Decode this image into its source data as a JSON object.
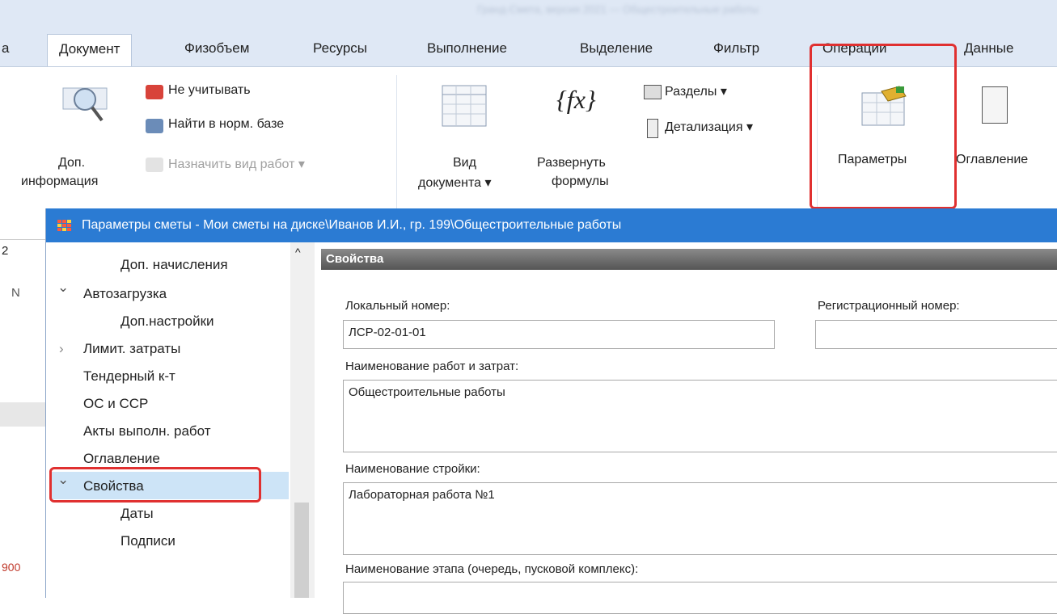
{
  "app": {
    "title_blurred": "Гранд-Смета, версия 2021 — Общестроительные работы"
  },
  "tabs": [
    {
      "label": "а"
    },
    {
      "label": "Документ"
    },
    {
      "label": "Физобъем"
    },
    {
      "label": "Ресурсы"
    },
    {
      "label": "Выполнение"
    },
    {
      "label": "Выделение"
    },
    {
      "label": "Фильтр"
    },
    {
      "label": "Операции"
    },
    {
      "label": "Данные"
    }
  ],
  "ribbon": {
    "dop_info": {
      "line1": "Доп.",
      "line2": "информация"
    },
    "ne_uchityvat": "Не учитывать",
    "nayti": "Найти в норм. базе",
    "naznachit": "Назначить вид работ ▾",
    "vid": {
      "line1": "Вид",
      "line2": "документа ▾"
    },
    "razvernut": {
      "line1": "Развернуть",
      "line2": "формулы",
      "icon_text": "{fx}"
    },
    "razdely": "Разделы ▾",
    "detalizaciya": "Детализация ▾",
    "parametry": "Параметры",
    "oglavlenie": "Оглавление"
  },
  "left_edge": {
    "n1": "2",
    "n2": "N",
    "n3": "900"
  },
  "dialog": {
    "title": "Параметры сметы - Мои сметы на диске\\Иванов И.И., гр. 199\\Общестроительные работы",
    "tree": [
      {
        "label": "Доп. начисления",
        "marker": ""
      },
      {
        "label": "Автозагрузка",
        "marker": "⌄"
      },
      {
        "label": "Доп.настройки",
        "marker": ""
      },
      {
        "label": "Лимит. затраты",
        "marker": "›"
      },
      {
        "label": "Тендерный к-т",
        "marker": ""
      },
      {
        "label": "ОС и ССР",
        "marker": ""
      },
      {
        "label": "Акты выполн. работ",
        "marker": ""
      },
      {
        "label": "Оглавление",
        "marker": ""
      },
      {
        "label": "Свойства",
        "marker": "⌄"
      },
      {
        "label": "Даты",
        "marker": ""
      },
      {
        "label": "Подписи",
        "marker": ""
      }
    ],
    "properties": {
      "header": "Свойства",
      "local_number_label": "Локальный номер:",
      "local_number_value": "ЛСР-02-01-01",
      "reg_number_label": "Регистрационный номер:",
      "reg_number_value": "",
      "work_name_label": "Наименование работ и затрат:",
      "work_name_value": "Общестроительные работы",
      "construction_label": "Наименование стройки:",
      "construction_value": "Лабораторная работа №1",
      "stage_label": "Наименование этапа (очередь, пусковой комплекс):",
      "stage_value": ""
    }
  },
  "colors": {
    "dialog_title_bg": "#2b7bd3",
    "highlight_red": "#e03030",
    "selected_tree_bg": "#cde4f7"
  }
}
